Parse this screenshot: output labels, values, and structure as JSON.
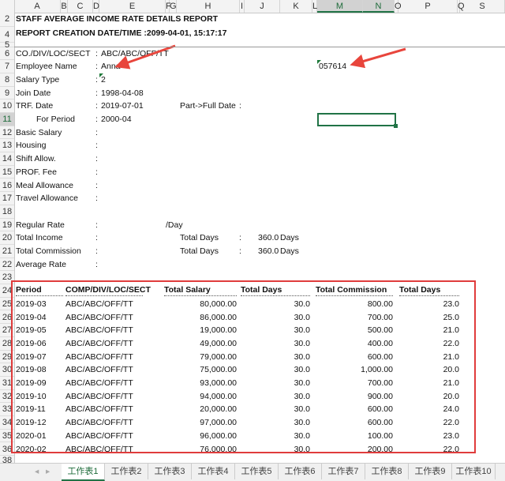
{
  "columns": [
    "A",
    "B",
    "C",
    "D",
    "E",
    "F",
    "G",
    "H",
    "I",
    "J",
    "K",
    "L",
    "M",
    "N",
    "O",
    "P",
    "Q",
    "S"
  ],
  "rows": [
    "2",
    "4",
    "5",
    "6",
    "7",
    "8",
    "9",
    "10",
    "11",
    "12",
    "13",
    "14",
    "15",
    "16",
    "17",
    "18",
    "19",
    "20",
    "21",
    "22",
    "23",
    "24",
    "25",
    "26",
    "27",
    "28",
    "29",
    "30",
    "31",
    "32",
    "33",
    "34",
    "35",
    "36",
    "38"
  ],
  "report": {
    "title": "STAFF AVERAGE INCOME RATE DETAILS REPORT",
    "creation": "REPORT CREATION DATE/TIME :2099-04-01, 15:17:17"
  },
  "fields": [
    {
      "label": "CO./DIV/LOC/SECT",
      "colon": ":",
      "value": "ABC/ABC/OFF/TT"
    },
    {
      "label": "Employee Name",
      "colon": ":",
      "value": "Anna"
    },
    {
      "label": "Salary Type",
      "colon": ":",
      "value": "2"
    },
    {
      "label": "Join Date",
      "colon": ":",
      "value": "1998-04-08"
    },
    {
      "label": "TRF. Date",
      "colon": ":",
      "value": "2019-07-01"
    },
    {
      "label": "For Period",
      "colon": ":",
      "value": "2000-04"
    },
    {
      "label": "Basic Salary",
      "colon": ":",
      "value": ""
    },
    {
      "label": "Housing",
      "colon": ":",
      "value": ""
    },
    {
      "label": "Shift Allow.",
      "colon": ":",
      "value": ""
    },
    {
      "label": "PROF. Fee",
      "colon": ":",
      "value": ""
    },
    {
      "label": "Meal Allowance",
      "colon": ":",
      "value": ""
    },
    {
      "label": "Travel Allowance",
      "colon": ":",
      "value": ""
    }
  ],
  "employee_id": "057614",
  "part_full": {
    "label": "Part->Full Date",
    "colon": ":"
  },
  "rates": [
    {
      "label": "Regular Rate",
      "colon": ":",
      "extra": "/Day"
    },
    {
      "label": "Total Income",
      "colon": ":",
      "days_label": "Total Days",
      "days_colon": ":",
      "days": "360.0",
      "unit": "Days"
    },
    {
      "label": "Total Commission",
      "colon": ":",
      "days_label": "Total Days",
      "days_colon": ":",
      "days": "360.0",
      "unit": "Days"
    },
    {
      "label": "Average Rate",
      "colon": ":"
    }
  ],
  "table": {
    "headers": [
      "Period",
      "COMP/DIV/LOC/SECT",
      "Total Salary",
      "Total Days",
      "Total Commission",
      "Total Days"
    ],
    "rows": [
      [
        "2019-03",
        "ABC/ABC/OFF/TT",
        "80,000.00",
        "30.0",
        "800.00",
        "23.0"
      ],
      [
        "2019-04",
        "ABC/ABC/OFF/TT",
        "86,000.00",
        "30.0",
        "700.00",
        "25.0"
      ],
      [
        "2019-05",
        "ABC/ABC/OFF/TT",
        "19,000.00",
        "30.0",
        "500.00",
        "21.0"
      ],
      [
        "2019-06",
        "ABC/ABC/OFF/TT",
        "49,000.00",
        "30.0",
        "400.00",
        "22.0"
      ],
      [
        "2019-07",
        "ABC/ABC/OFF/TT",
        "79,000.00",
        "30.0",
        "600.00",
        "21.0"
      ],
      [
        "2019-08",
        "ABC/ABC/OFF/TT",
        "75,000.00",
        "30.0",
        "1,000.00",
        "20.0"
      ],
      [
        "2019-09",
        "ABC/ABC/OFF/TT",
        "93,000.00",
        "30.0",
        "700.00",
        "21.0"
      ],
      [
        "2019-10",
        "ABC/ABC/OFF/TT",
        "94,000.00",
        "30.0",
        "900.00",
        "20.0"
      ],
      [
        "2019-11",
        "ABC/ABC/OFF/TT",
        "20,000.00",
        "30.0",
        "600.00",
        "24.0"
      ],
      [
        "2019-12",
        "ABC/ABC/OFF/TT",
        "97,000.00",
        "30.0",
        "600.00",
        "22.0"
      ],
      [
        "2020-01",
        "ABC/ABC/OFF/TT",
        "96,000.00",
        "30.0",
        "100.00",
        "23.0"
      ],
      [
        "2020-02",
        "ABC/ABC/OFF/TT",
        "76,000.00",
        "30.0",
        "200.00",
        "22.0"
      ]
    ]
  },
  "sheets": [
    "工作表1",
    "工作表2",
    "工作表3",
    "工作表4",
    "工作表5",
    "工作表6",
    "工作表7",
    "工作表8",
    "工作表9",
    "工作表10"
  ],
  "colors": {
    "accent": "#217346",
    "highlight": "#e03c3c"
  }
}
